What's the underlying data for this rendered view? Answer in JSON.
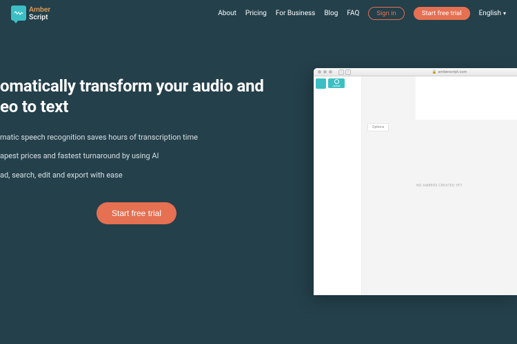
{
  "logo": {
    "line1": "Amber",
    "line2": "Script"
  },
  "nav": {
    "about": "About",
    "pricing": "Pricing",
    "business": "For Business",
    "blog": "Blog",
    "faq": "FAQ",
    "signin": "Sign in",
    "trial": "Start free trial",
    "lang": "English"
  },
  "hero": {
    "title_line1": "omatically transform your audio and",
    "title_line2": "eo to text",
    "bullet1": "matic speech recognition saves hours of transcription time",
    "bullet2": "apest prices and fastest turnaround by using AI",
    "bullet3": "ad, search, edit and export with ease",
    "cta": "Start free trial"
  },
  "browser": {
    "url": "amberscript.com",
    "upload": "Upload",
    "options": "Options",
    "empty": "NO AMBERS CREATED YET"
  }
}
